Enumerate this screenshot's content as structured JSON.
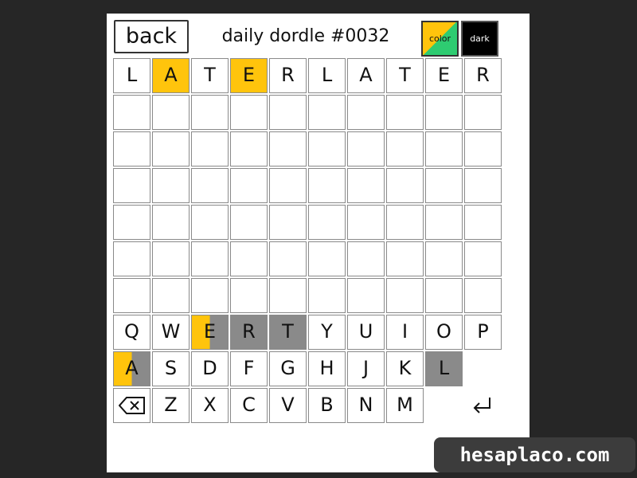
{
  "header": {
    "back_label": "back",
    "title": "daily dordle #0032",
    "color_label": "color",
    "dark_label": "dark"
  },
  "colors": {
    "present": "#ffc40c",
    "absent": "#8a8a8a",
    "correct": "#2ecc71"
  },
  "guess_row": {
    "letters": [
      "L",
      "A",
      "T",
      "E",
      "R",
      "L",
      "A",
      "T",
      "E",
      "R"
    ],
    "states": [
      "empty",
      "present",
      "empty",
      "present",
      "empty",
      "empty",
      "empty",
      "empty",
      "empty",
      "empty"
    ]
  },
  "empty_rows": 6,
  "keyboard": {
    "row1": [
      "Q",
      "W",
      "E",
      "R",
      "T",
      "Y",
      "U",
      "I",
      "O",
      "P"
    ],
    "row1_states": [
      "none",
      "none",
      "split-present-absent",
      "absent",
      "absent",
      "none",
      "none",
      "none",
      "none",
      "none"
    ],
    "row2": [
      "A",
      "S",
      "D",
      "F",
      "G",
      "H",
      "J",
      "K",
      "L",
      ""
    ],
    "row2_states": [
      "split-present-absent",
      "none",
      "none",
      "none",
      "none",
      "none",
      "none",
      "none",
      "absent",
      "blank"
    ],
    "row3": [
      "",
      "Z",
      "X",
      "C",
      "V",
      "B",
      "N",
      "M",
      "",
      ""
    ],
    "row3_icons": {
      "0": "backspace-icon",
      "9": "enter-icon"
    }
  },
  "watermark": "hesaplaco.com"
}
